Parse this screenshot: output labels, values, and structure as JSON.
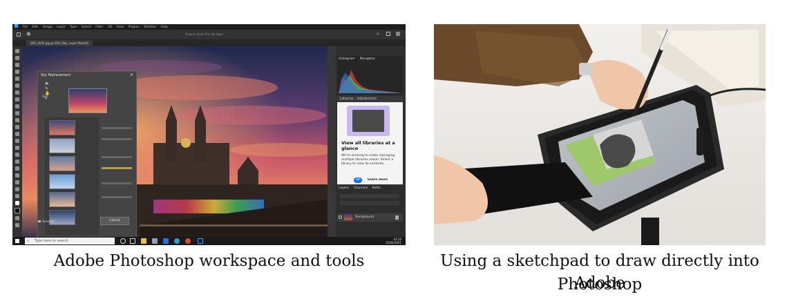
{
  "captions": {
    "left": "Adobe Photoshop workspace and tools",
    "right_line1": "Using a sketchpad to draw directly into Adobe",
    "right_line2": "Photoshop"
  },
  "photoshop": {
    "menu": [
      "File",
      "Edit",
      "Image",
      "Layer",
      "Type",
      "Select",
      "Filter",
      "3D",
      "View",
      "Plugins",
      "Window",
      "Help"
    ],
    "options_hint": "Drag to move the sky layer.",
    "doc_tab": "DSC_0045.jpg @ 50% (Sky, Layer Mask/8)",
    "dialog": {
      "title": "Sky Replacement",
      "close": "×",
      "sky_label": "Sky:",
      "folder": "Sunsets",
      "cancel": "Cancel"
    },
    "panels": {
      "histogram_tabs": [
        "Histogram",
        "Navigator"
      ],
      "library_tabs": [
        "Libraries",
        "Adjustments"
      ],
      "library_heading": "View all libraries at a glance",
      "library_body": "We're working to make managing multiple libraries easier. Select a library to view its contents.",
      "library_ok": "OK",
      "library_more": "Learn more",
      "layers_tabs": [
        "Layers",
        "Channels",
        "Paths"
      ],
      "layer_name": "Background"
    },
    "taskbar": {
      "search_placeholder": "Type here to search",
      "time": "14:16",
      "date": "25/02/2021"
    }
  },
  "colors": {
    "sky_top": "#2c3e6b",
    "sky_glow": "#e8735a",
    "building": "#4a3a30",
    "ps_dark": "#2b2b2b"
  }
}
